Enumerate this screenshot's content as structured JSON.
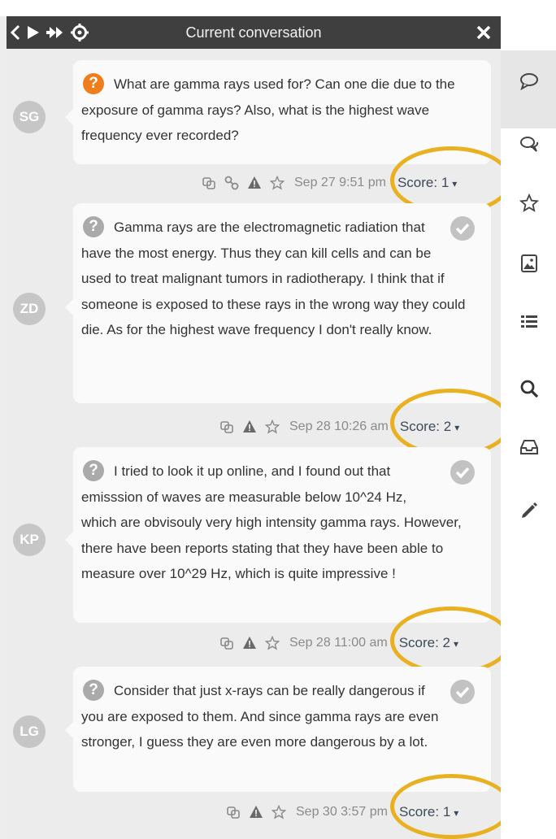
{
  "window": {
    "title": "Current conversation",
    "nav_icons": [
      "chevron-left-icon",
      "play-icon",
      "fast-forward-icon",
      "gear-icon"
    ],
    "close_icon": "close-icon"
  },
  "sidebar": {
    "icons": [
      "comment-icon",
      "comments-icon",
      "star-icon",
      "image-icon",
      "list-icon",
      "search-icon",
      "inbox-icon",
      "pencil-icon"
    ]
  },
  "colors": {
    "title_bar": "#3f3f3f",
    "question_badge": "#ef7d1c",
    "highlight_ring": "#e9b020",
    "score_text": "#3d4a5a"
  },
  "messages": [
    {
      "initials": "SG",
      "text": "What are gamma rays used for? Can one die due to the exposure of gamma rays? Also, what is the highest wave frequency ever recorded?",
      "timestamp": "Sep 27 9:51 pm",
      "score": "Score: 1"
    },
    {
      "initials": "ZD",
      "text": "Gamma rays are the electromagnetic radiation that have the most energy. Thus they can kill cells and can be used to treat malignant tumors in radiotherapy. I think that if someone is exposed to these rays in the wrong way they could die. As for the highest wave frequency I don't really know.",
      "timestamp": "Sep 28 10:26 am",
      "score": "Score: 2"
    },
    {
      "initials": "KP",
      "text": "I tried to look it up online, and I found out that emisssion of waves are measurable below 10^24 Hz, which are obvisouly very high intensity gamma rays. However, there have been reports stating that they have been able to measure over 10^29 Hz, which is quite impressive !",
      "timestamp": "Sep 28 11:00 am",
      "score": "Score: 2"
    },
    {
      "initials": "LG",
      "text": "Consider that just x-rays can be really dangerous if you are exposed to them. And since gamma rays are even stronger, I guess they are even more dangerous by a lot.",
      "timestamp": "Sep 30 3:57 pm",
      "score": "Score: 1"
    }
  ]
}
